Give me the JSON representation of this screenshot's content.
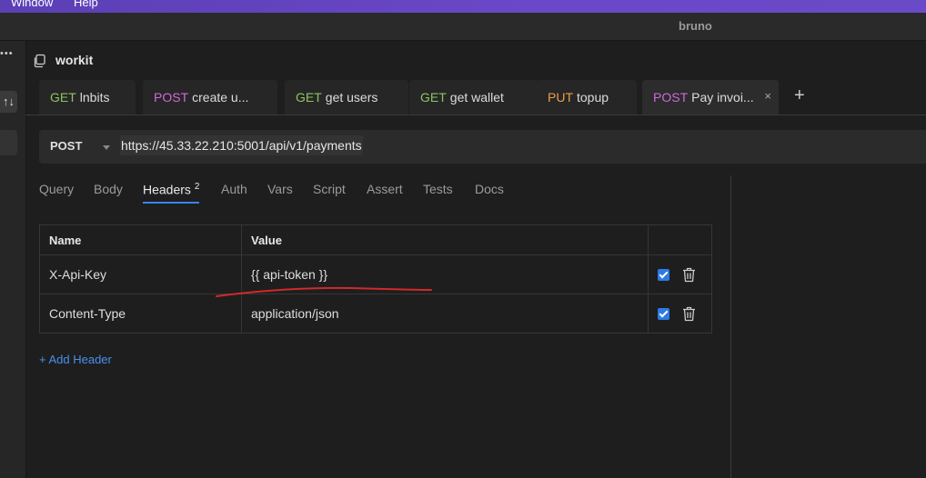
{
  "menu": {
    "window": "Window",
    "help": "Help"
  },
  "app": {
    "title": "bruno"
  },
  "sidebar": {
    "menu_glyph": "•••",
    "sort_glyph": "↑↓"
  },
  "collection": {
    "name": "workit",
    "icon": "copy-icon"
  },
  "tabs": [
    {
      "method": "GET",
      "name": "lnbits"
    },
    {
      "method": "POST",
      "name": "create u..."
    },
    {
      "method": "GET",
      "name": "get users"
    },
    {
      "method": "GET",
      "name": "get wallet"
    },
    {
      "method": "PUT",
      "name": "topup"
    },
    {
      "method": "POST",
      "name": "Pay invoi...",
      "active": true,
      "close": "×"
    }
  ],
  "add_tab": "+",
  "request": {
    "method": "POST",
    "url": "https://45.33.22.210:5001/api/v1/payments"
  },
  "request_tabs": {
    "query": "Query",
    "body": "Body",
    "headers": "Headers",
    "headers_count": "2",
    "auth": "Auth",
    "vars": "Vars",
    "script": "Script",
    "assert": "Assert",
    "tests": "Tests",
    "docs": "Docs"
  },
  "headers_table": {
    "col_name": "Name",
    "col_value": "Value",
    "rows": [
      {
        "name": "X-Api-Key",
        "value": "{{ api-token }}",
        "enabled": true
      },
      {
        "name": "Content-Type",
        "value": "application/json",
        "enabled": true
      }
    ]
  },
  "add_header": "+ Add Header",
  "colors": {
    "get": "#8cc461",
    "post": "#d06ad8",
    "put": "#e9a04b",
    "accent": "#3b82f6",
    "variable": "#ee6a4a",
    "annotation": "#d02a2a"
  }
}
